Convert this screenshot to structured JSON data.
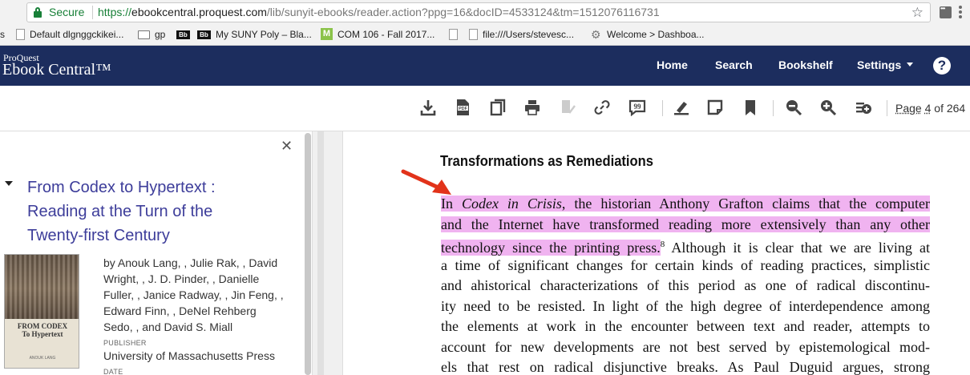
{
  "browser": {
    "secure_label": "Secure",
    "url_scheme": "https://",
    "url_host": "ebookcentral.proquest.com",
    "url_path": "/lib/sunyit-ebooks/reader.action?ppg=16&docID=4533124&tm=1512076116731",
    "star_icon": "bookmark-star-icon"
  },
  "bookmarks": [
    {
      "label": "s",
      "icon": "none"
    },
    {
      "label": "Default dlgnggckikei...",
      "icon": "page-icon"
    },
    {
      "label": "gp",
      "icon": "folder-icon"
    },
    {
      "label": "",
      "icon": "bb-icon"
    },
    {
      "label": "My SUNY Poly – Bla...",
      "icon": "bb-icon"
    },
    {
      "label": "COM 106 - Fall 2017...",
      "icon": "m-icon"
    },
    {
      "label": "",
      "icon": "page-icon"
    },
    {
      "label": "file:///Users/stevesc...",
      "icon": "page-icon"
    },
    {
      "label": "Welcome > Dashboa...",
      "icon": "gear-icon"
    }
  ],
  "bookmark_badges": {
    "bb": "Bb",
    "m": "M"
  },
  "app": {
    "logo_top": "ProQuest",
    "logo_main": "Ebook Central™",
    "nav": {
      "home": "Home",
      "search": "Search",
      "bookshelf": "Bookshelf",
      "settings": "Settings"
    },
    "help_glyph": "?"
  },
  "toolbar": {
    "icons": [
      "download-icon",
      "pdf-icon",
      "copy-icon",
      "print-icon",
      "share-icon",
      "link-icon",
      "cite-icon",
      "highlight-icon",
      "note-icon",
      "bookmark-icon",
      "zoom-out-icon",
      "zoom-in-icon",
      "add-to-bookshelf-icon"
    ],
    "page_prefix": "Page",
    "page_current": "4",
    "page_of": "of 264"
  },
  "sidebar": {
    "close_glyph": "✕",
    "book_title": "From Codex to Hypertext : Reading at the Turn of the Twenty-first Century",
    "cover_title_1": "FROM CODEX",
    "cover_title_2": "To Hypertext",
    "cover_author": "ANOUK LANG",
    "authors": "by Anouk Lang, , Julie Rak, , David Wright, , J. D. Pinder, , Danielle Fuller, , Janice Radway, , Jin Feng, , Edward Finn, , DeNel Rehberg Sedo, , and David S. Miall",
    "publisher_label": "PUBLISHER",
    "publisher_value": "University of Massachusetts Press",
    "date_label": "DATE"
  },
  "page_content": {
    "heading": "Transformations as Remediations",
    "lines": [
      {
        "hl": "In ",
        "hl_italic": "Codex in Crisis",
        "hl_rest": ", the historian Anthony Grafton claims that the computer",
        "rest": ""
      },
      {
        "hl": "and the Internet have transformed reading more extensively than any other",
        "rest": ""
      },
      {
        "hl": "technology since the printing press.",
        "sup": "8",
        "rest": " Although it is clear that we are living at"
      },
      {
        "rest": "a time of significant changes for certain kinds of reading practices, simplistic"
      },
      {
        "rest": "and ahistorical characterizations of this period as one of radical discontinu-"
      },
      {
        "rest": "ity need to be resisted. In light of the high degree of interdependence among"
      },
      {
        "rest": "the elements at work in the encounter between text and reader, attempts to"
      },
      {
        "rest": "account for new developments are not best served by epistemological mod-"
      },
      {
        "rest": "els that rest on radical disjunctive breaks. As Paul Duguid argues, strong"
      }
    ],
    "highlight_color": "#f0b3f0",
    "annotation_arrow_color": "#e2331a"
  }
}
